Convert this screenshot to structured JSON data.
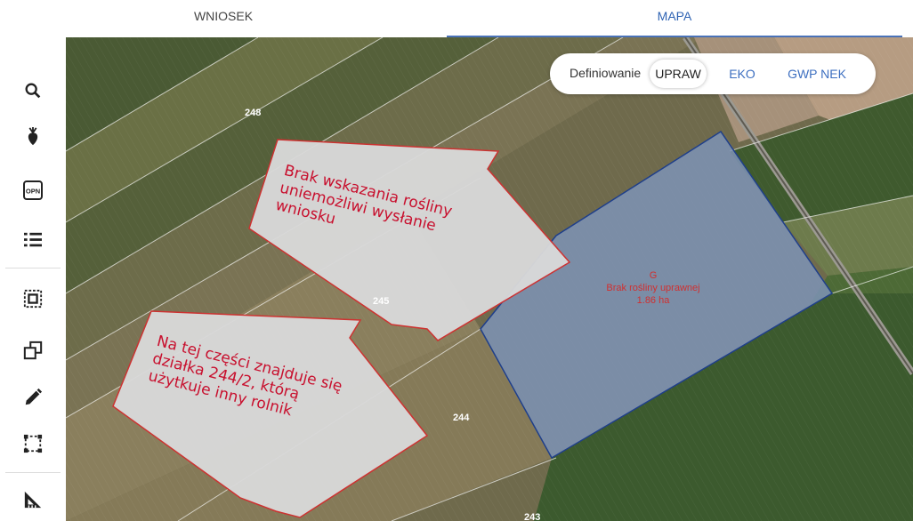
{
  "tabs": {
    "wniosek": "WNIOSEK",
    "mapa": "MAPA"
  },
  "definiowanie": {
    "label": "Definiowanie",
    "upraw": "UPRAW",
    "eko": "EKO",
    "gwp": "GWP NEK"
  },
  "parcels": {
    "p248": "248",
    "p245": "245",
    "p244": "244",
    "p243": "243"
  },
  "plot": {
    "code": "G",
    "status": "Brak rośliny uprawnej",
    "area": "1.86 ha"
  },
  "annotations": {
    "top": [
      "Brak wskazania rośliny",
      "uniemożliwi wysłanie",
      "wniosku"
    ],
    "bottom": [
      "Na tej części znajduje się",
      "działka 244/2, którą",
      "użytkuje inny rolnik"
    ]
  },
  "icons": [
    "search-icon",
    "crop-icon",
    "opn-icon",
    "list-icon",
    "select-area-icon",
    "copy-icon",
    "pencil-icon",
    "dashed-rect-icon",
    "measure-icon"
  ],
  "colors": {
    "accent": "#2f63b3",
    "annotation": "#c8102e",
    "plot_fill": "#7e93b6",
    "plot_border": "#1f3f8a"
  }
}
